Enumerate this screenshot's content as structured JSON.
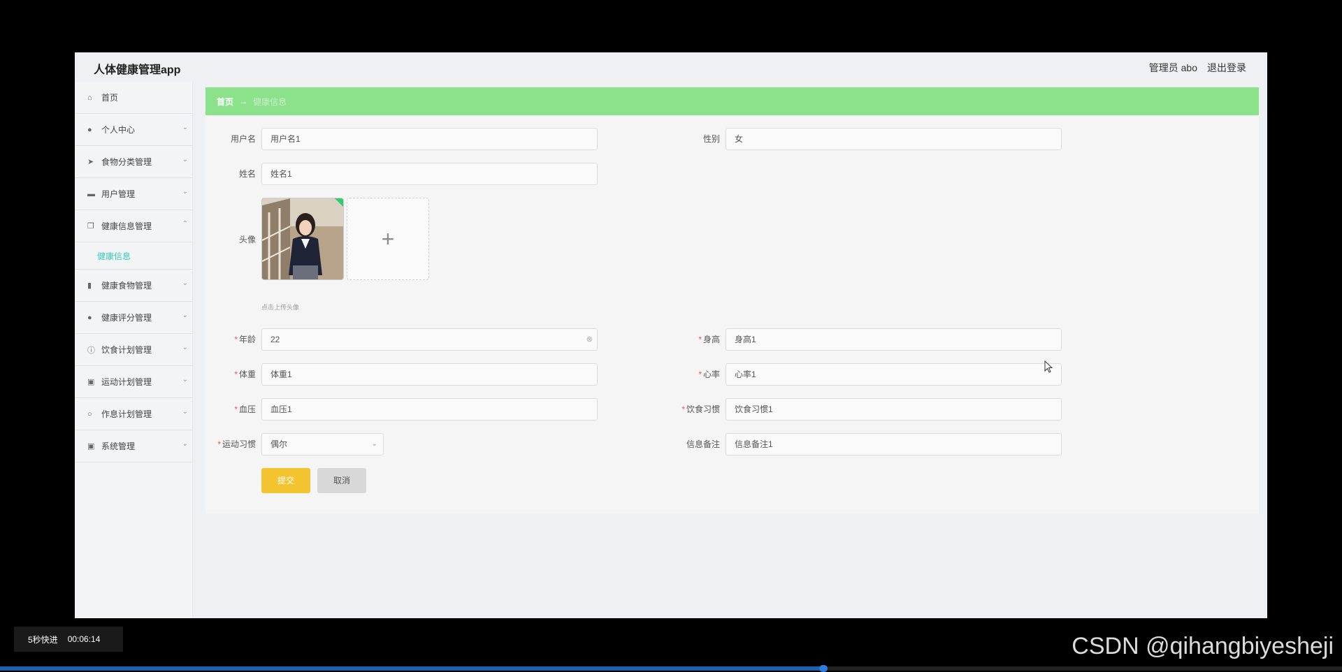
{
  "app": {
    "title": "人体健康管理app",
    "admin": "管理员 abo",
    "logout": "退出登录"
  },
  "sidebar": {
    "items": [
      {
        "label": "首页",
        "icon": "home-icon",
        "glyph": "⌂"
      },
      {
        "label": "个人中心",
        "icon": "user-icon",
        "glyph": "●"
      },
      {
        "label": "食物分类管理",
        "icon": "send-icon",
        "glyph": "➤"
      },
      {
        "label": "用户管理",
        "icon": "briefcase-icon",
        "glyph": "▬"
      },
      {
        "label": "健康信息管理",
        "icon": "copy-icon",
        "glyph": "❐"
      },
      {
        "label": "健康食物管理",
        "icon": "bar-chart-icon",
        "glyph": "▮"
      },
      {
        "label": "健康评分管理",
        "icon": "user-icon",
        "glyph": "●"
      },
      {
        "label": "饮食计划管理",
        "icon": "info-icon",
        "glyph": "ⓘ"
      },
      {
        "label": "运动计划管理",
        "icon": "clipboard-icon",
        "glyph": "▣"
      },
      {
        "label": "作息计划管理",
        "icon": "circle-icon",
        "glyph": "○"
      },
      {
        "label": "系统管理",
        "icon": "clipboard-icon",
        "glyph": "▣"
      }
    ],
    "sub_item": "健康信息"
  },
  "breadcrumb": {
    "home": "首页",
    "sep": "→",
    "current": "健康信息"
  },
  "form": {
    "username_label": "用户名",
    "username_value": "用户名1",
    "gender_label": "性别",
    "gender_value": "女",
    "name_label": "姓名",
    "name_value": "姓名1",
    "avatar_label": "头像",
    "upload_hint": "点击上传头像",
    "upload_plus": "+",
    "age_label": "年龄",
    "age_value": "22",
    "height_label": "身高",
    "height_value": "身高1",
    "weight_label": "体重",
    "weight_value": "体重1",
    "heartrate_label": "心率",
    "heartrate_value": "心率1",
    "bp_label": "血压",
    "bp_value": "血压1",
    "diet_label": "饮食习惯",
    "diet_value": "饮食习惯1",
    "exercise_label": "运动习惯",
    "exercise_value": "偶尔",
    "note_label": "信息备注",
    "note_value": "信息备注1",
    "submit": "提交",
    "cancel": "取消"
  },
  "player": {
    "skip": "5秒快进",
    "time": "00:06:14",
    "progress": 0.613
  },
  "watermark": "CSDN @qihangbiyesheji"
}
